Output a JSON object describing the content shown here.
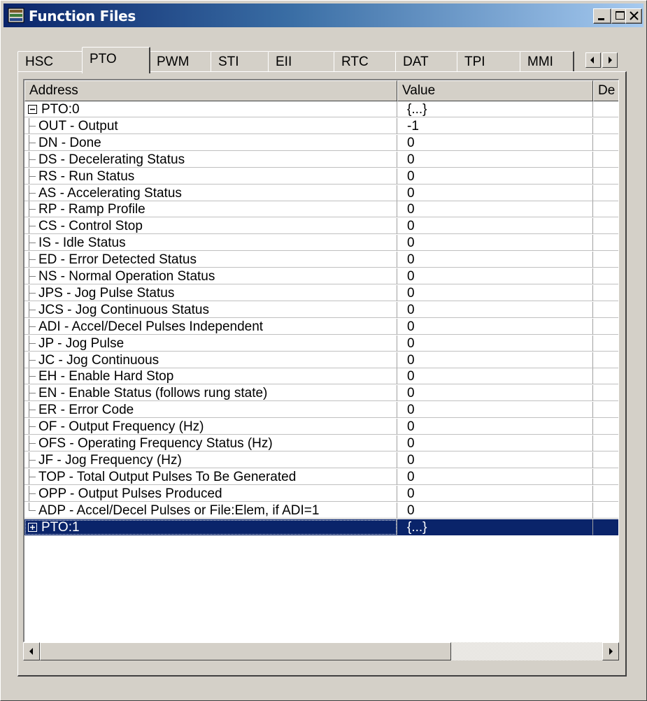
{
  "window": {
    "title": "Function Files"
  },
  "tabs": [
    {
      "label": "HSC",
      "active": false
    },
    {
      "label": "PTO",
      "active": true
    },
    {
      "label": "PWM",
      "active": false
    },
    {
      "label": "STI",
      "active": false
    },
    {
      "label": "EII",
      "active": false
    },
    {
      "label": "RTC",
      "active": false
    },
    {
      "label": "DAT",
      "active": false
    },
    {
      "label": "TPI",
      "active": false
    },
    {
      "label": "MMI",
      "active": false
    }
  ],
  "columns": {
    "address": "Address",
    "value": "Value",
    "description": "De"
  },
  "rows": [
    {
      "address": "PTO:0",
      "value": "{...}",
      "expander": "minus",
      "level": 0
    },
    {
      "address": "OUT - Output",
      "value": "-1",
      "level": 1
    },
    {
      "address": "DN - Done",
      "value": "0",
      "level": 1
    },
    {
      "address": "DS - Decelerating Status",
      "value": "0",
      "level": 1
    },
    {
      "address": "RS - Run Status",
      "value": "0",
      "level": 1
    },
    {
      "address": "AS - Accelerating Status",
      "value": "0",
      "level": 1
    },
    {
      "address": "RP - Ramp Profile",
      "value": "0",
      "level": 1
    },
    {
      "address": "CS - Control Stop",
      "value": "0",
      "level": 1
    },
    {
      "address": "IS - Idle Status",
      "value": "0",
      "level": 1
    },
    {
      "address": "ED - Error Detected Status",
      "value": "0",
      "level": 1
    },
    {
      "address": "NS - Normal Operation Status",
      "value": "0",
      "level": 1
    },
    {
      "address": "JPS - Jog Pulse Status",
      "value": "0",
      "level": 1
    },
    {
      "address": "JCS - Jog Continuous Status",
      "value": "0",
      "level": 1
    },
    {
      "address": "ADI - Accel/Decel Pulses Independent",
      "value": "0",
      "level": 1
    },
    {
      "address": "JP - Jog Pulse",
      "value": "0",
      "level": 1
    },
    {
      "address": "JC - Jog Continuous",
      "value": "0",
      "level": 1
    },
    {
      "address": "EH - Enable Hard Stop",
      "value": "0",
      "level": 1
    },
    {
      "address": "EN - Enable Status (follows rung state)",
      "value": "0",
      "level": 1
    },
    {
      "address": "ER - Error Code",
      "value": "0",
      "level": 1
    },
    {
      "address": "OF - Output Frequency (Hz)",
      "value": "0",
      "level": 1
    },
    {
      "address": "OFS - Operating Frequency Status (Hz)",
      "value": "0",
      "level": 1
    },
    {
      "address": "JF - Jog Frequency (Hz)",
      "value": "0",
      "level": 1
    },
    {
      "address": "TOP - Total Output Pulses To Be Generated",
      "value": "0",
      "level": 1
    },
    {
      "address": "OPP - Output Pulses Produced",
      "value": "0",
      "level": 1
    },
    {
      "address": "ADP - Accel/Decel Pulses or File:Elem, if ADI=1",
      "value": "0",
      "level": 1,
      "last": true
    },
    {
      "address": "PTO:1",
      "value": "{...}",
      "expander": "plus",
      "level": 0,
      "selected": true
    }
  ],
  "colors": {
    "selection": "#0a246a",
    "face": "#d4d0c8",
    "title_start": "#0a246a",
    "title_end": "#a6caf0"
  }
}
